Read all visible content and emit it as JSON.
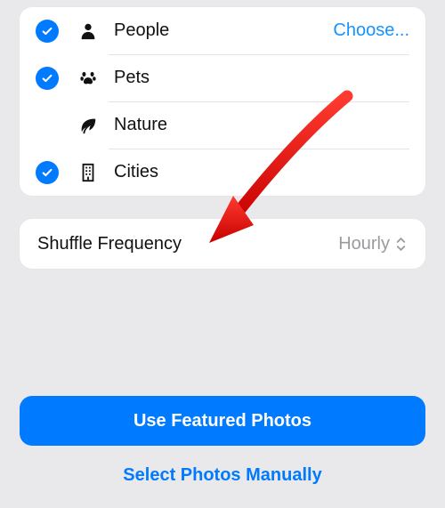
{
  "categories": {
    "choose_label": "Choose...",
    "items": [
      {
        "label": "People",
        "checked": true,
        "has_choose": true
      },
      {
        "label": "Pets",
        "checked": true,
        "has_choose": false
      },
      {
        "label": "Nature",
        "checked": false,
        "has_choose": false
      },
      {
        "label": "Cities",
        "checked": true,
        "has_choose": false
      }
    ]
  },
  "setting": {
    "label": "Shuffle Frequency",
    "value": "Hourly"
  },
  "buttons": {
    "primary": "Use Featured Photos",
    "secondary": "Select Photos Manually"
  }
}
